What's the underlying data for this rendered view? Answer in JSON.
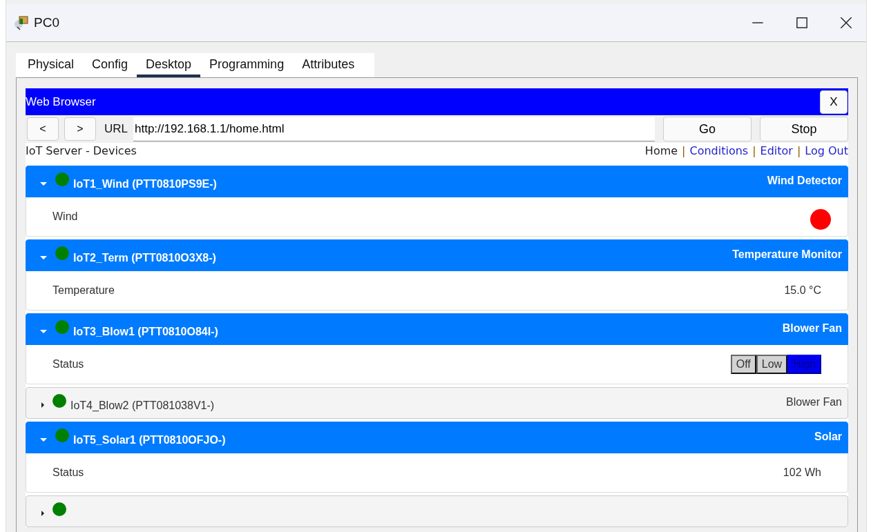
{
  "window": {
    "title": "PC0"
  },
  "tabs": [
    {
      "label": "Physical",
      "selected": false
    },
    {
      "label": "Config",
      "selected": false
    },
    {
      "label": "Desktop",
      "selected": true
    },
    {
      "label": "Programming",
      "selected": false
    },
    {
      "label": "Attributes",
      "selected": false
    }
  ],
  "browser": {
    "title": "Web Browser",
    "close": "X",
    "back": "<",
    "forward": ">",
    "url_label": "URL",
    "url": "http://192.168.1.1/home.html",
    "go": "Go",
    "stop": "Stop"
  },
  "page": {
    "heading": "IoT Server - Devices",
    "separator": "|",
    "nav": [
      {
        "label": "Home",
        "kind": "current"
      },
      {
        "label": "Conditions",
        "kind": "link"
      },
      {
        "label": "Editor",
        "kind": "link"
      },
      {
        "label": "Log Out",
        "kind": "link"
      }
    ],
    "devices": [
      {
        "name": "IoT1_Wind (PTT0810PS9E-)",
        "type": "Wind Detector",
        "color": "#008000",
        "expanded": true,
        "properties": [
          {
            "label": "Wind",
            "kind": "dot",
            "color": "#ff0000"
          }
        ]
      },
      {
        "name": "IoT2_Term (PTT0810O3X8-)",
        "type": "Temperature Monitor",
        "color": "#008000",
        "expanded": true,
        "properties": [
          {
            "label": "Temperature",
            "kind": "text",
            "value": "15.0 °C"
          }
        ]
      },
      {
        "name": "IoT3_Blow1 (PTT0810O84I-)",
        "type": "Blower Fan",
        "color": "#008000",
        "expanded": true,
        "properties": [
          {
            "label": "Status",
            "kind": "buttons",
            "options": [
              {
                "label": "Off",
                "selected": false
              },
              {
                "label": "Low",
                "selected": false
              },
              {
                "label": "High",
                "selected": true
              }
            ]
          }
        ]
      },
      {
        "name": "IoT4_Blow2 (PTT081038V1-)",
        "type": "Blower Fan",
        "color": "#008000",
        "expanded": false
      },
      {
        "name": "IoT5_Solar1 (PTT0810OFJO-)",
        "type": "Solar",
        "color": "#008000",
        "expanded": true,
        "properties": [
          {
            "label": "Status",
            "kind": "text",
            "value": "102 Wh"
          }
        ]
      },
      {
        "color": "#008000",
        "expanded": false
      }
    ]
  }
}
